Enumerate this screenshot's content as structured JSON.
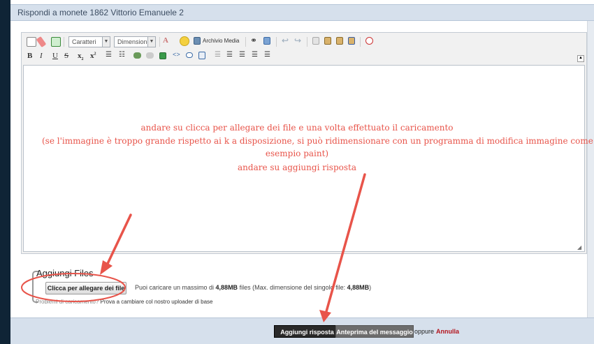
{
  "window": {
    "title": "Rispondi a monete 1862 Vittorio Emanuele 2"
  },
  "toolbar": {
    "font_select": "Caratteri",
    "size_select": "Dimensione",
    "media_label": "Archivio Media",
    "icons_row1": [
      "view-source-icon",
      "eraser-icon",
      "spellcheck-icon",
      "font-color-icon",
      "smiley-icon",
      "media-archive-icon",
      "binoculars-icon",
      "replace-icon",
      "undo-icon",
      "redo-icon",
      "copy-icon",
      "paste-icon",
      "paste-text-icon",
      "paste-word-icon",
      "remove-format-icon"
    ],
    "icons_row2": [
      "bold-icon",
      "italic-icon",
      "underline-icon",
      "strikethrough-icon",
      "subscript-icon",
      "superscript-icon",
      "bulleted-list-icon",
      "numbered-list-icon",
      "link-icon",
      "unlink-icon",
      "image-icon",
      "code-icon",
      "quote-icon",
      "table-icon",
      "align-left-icon",
      "align-center-icon",
      "align-right-icon",
      "justify-icon"
    ]
  },
  "annotation": {
    "line1": "andare su clicca per allegare dei file e una volta effettuato il caricamento",
    "line2": "(se l'immagine è troppo grande rispetto ai k a disposizione, si può ridimensionare con un programma di modifica immagine come ad",
    "line3": "esempio paint)",
    "line4": "andare su aggiungi risposta",
    "color": "#e8544a"
  },
  "attachments": {
    "title": "Aggiungi Files",
    "upload_button": "Clicca per allegare dei file",
    "info_prefix": "Puoi caricare un massimo di ",
    "max_total": "4,88MB",
    "info_middle": " files (Max. dimensione del singolo file: ",
    "max_single": "4,88MB",
    "info_suffix": ")",
    "problem_text": "Problemi di caricamento? ",
    "problem_link": "Prova a cambiare col nostro uploader di base"
  },
  "actions": {
    "submit_label": "Aggiungi risposta",
    "preview_label": "Anteprima del messaggio",
    "or_text": "oppure",
    "cancel_label": "Annulla"
  }
}
